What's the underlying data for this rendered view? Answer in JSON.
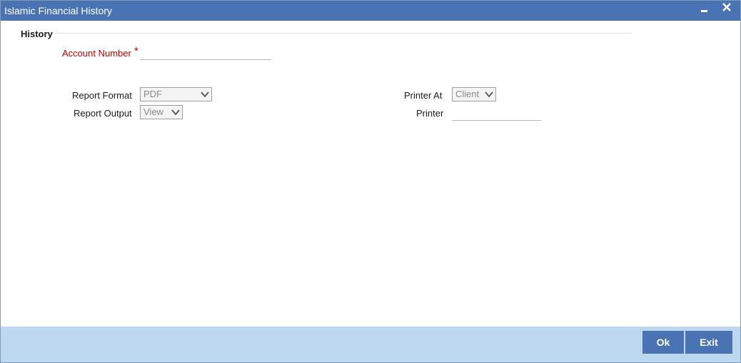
{
  "window": {
    "title": "Islamic Financial History",
    "minimize_icon": "minimize-icon",
    "close_icon": "close-icon"
  },
  "section": {
    "title": "History"
  },
  "form": {
    "account_number": {
      "label": "Account Number",
      "required_mark": "*",
      "value": ""
    },
    "report_format": {
      "label": "Report Format",
      "value": "PDF"
    },
    "report_output": {
      "label": "Report Output",
      "value": "View"
    },
    "printer_at": {
      "label": "Printer At",
      "value": "Client"
    },
    "printer": {
      "label": "Printer",
      "value": ""
    }
  },
  "footer": {
    "ok_label": "Ok",
    "exit_label": "Exit"
  },
  "colors": {
    "titlebar": "#4a73b3",
    "footer": "#bdd7ee",
    "required": "#c00000"
  }
}
